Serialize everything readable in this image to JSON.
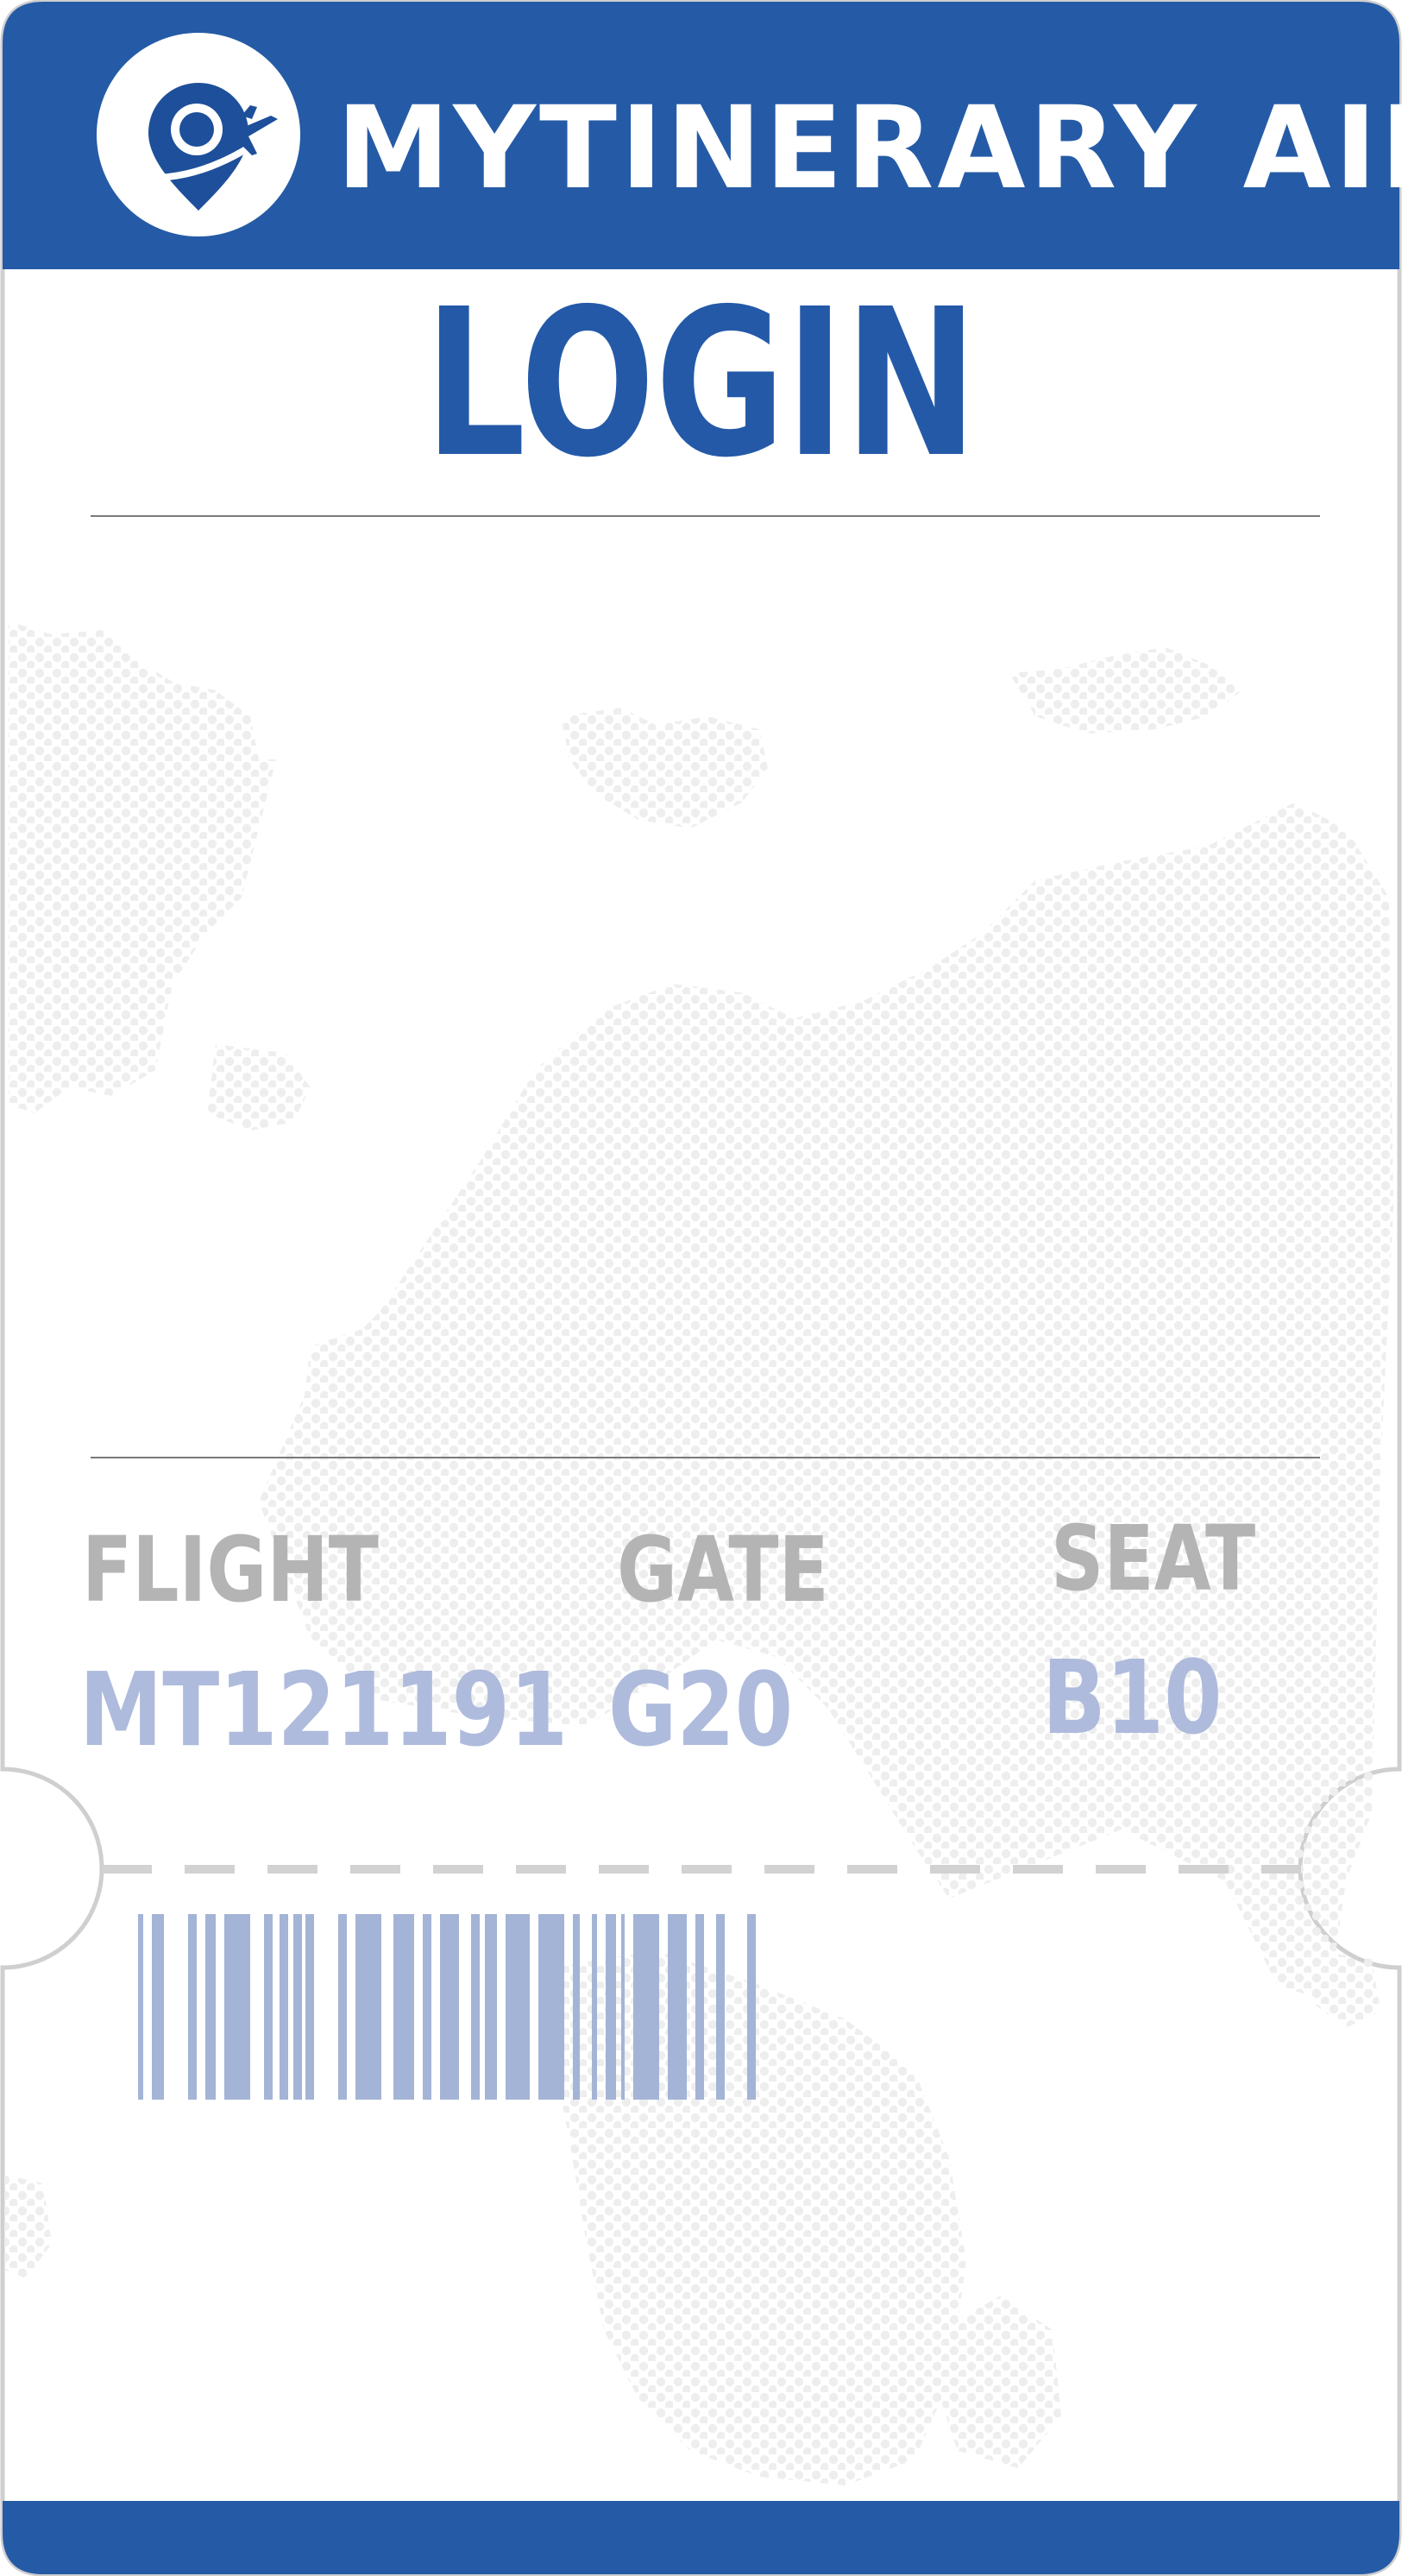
{
  "header": {
    "brand": "MYTINERARY AIR",
    "logo_icon": "location-pin-plane-icon",
    "bar_color": "#255ba6"
  },
  "page": {
    "title": "LOGIN",
    "title_color": "#2459a8",
    "background_pattern": "dotted-world-map"
  },
  "ticket": {
    "flight": {
      "label": "FLIGHT",
      "value": "MT121191"
    },
    "gate": {
      "label": "GATE",
      "value": "G20"
    },
    "seat": {
      "label": "SEAT",
      "value": "B10"
    },
    "label_color": "#b4b4b4",
    "value_color": "#aebbdc",
    "barcode_color": "#a4b4d6",
    "barcode_icon": "barcode"
  }
}
